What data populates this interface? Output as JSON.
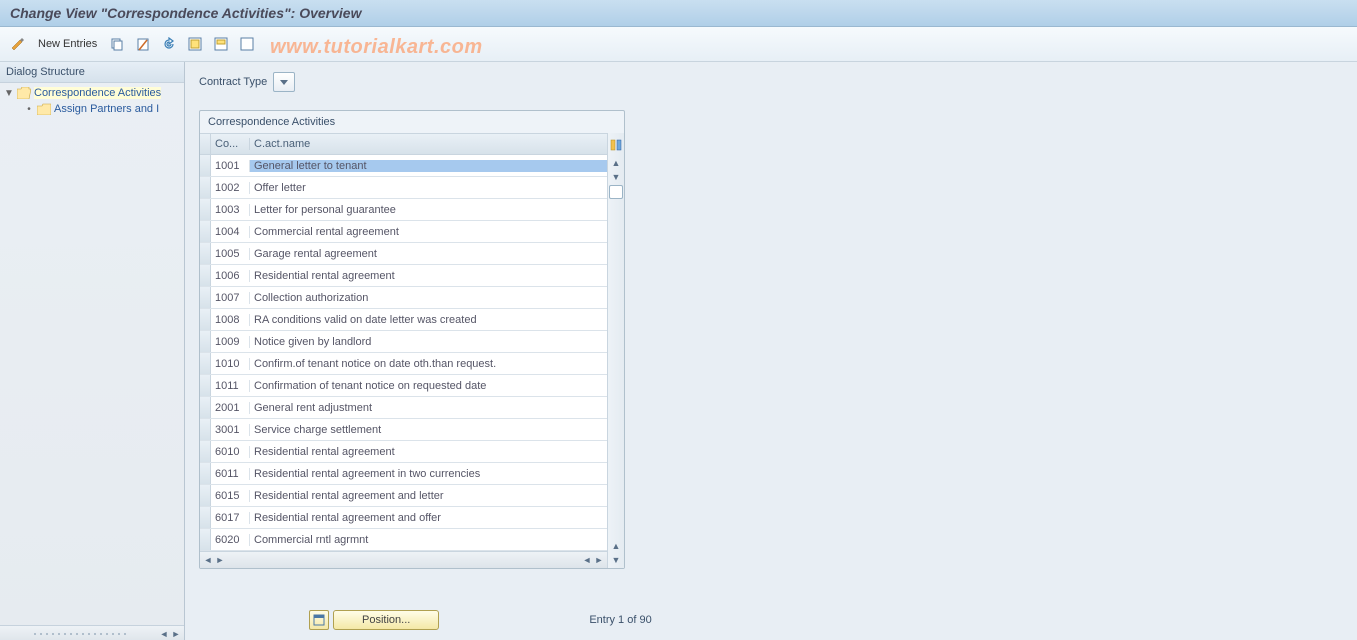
{
  "title": "Change View \"Correspondence Activities\": Overview",
  "watermark": "www.tutorialkart.com",
  "toolbar": {
    "new_entries_label": "New Entries"
  },
  "tree": {
    "header": "Dialog Structure",
    "nodes": [
      {
        "label": "Correspondence Activities",
        "expanded": true,
        "selected": true,
        "open": true
      },
      {
        "label": "Assign Partners and I",
        "expanded": false,
        "selected": false,
        "open": false
      }
    ]
  },
  "contract_type": {
    "label": "Contract Type",
    "value": ""
  },
  "table": {
    "title": "Correspondence Activities",
    "columns": {
      "code": "Co...",
      "name": "C.act.name"
    },
    "rows": [
      {
        "code": "1001",
        "name": "General letter to tenant",
        "selected": true
      },
      {
        "code": "1002",
        "name": "Offer letter"
      },
      {
        "code": "1003",
        "name": "Letter for personal guarantee"
      },
      {
        "code": "1004",
        "name": "Commercial rental agreement"
      },
      {
        "code": "1005",
        "name": "Garage rental agreement"
      },
      {
        "code": "1006",
        "name": "Residential rental agreement"
      },
      {
        "code": "1007",
        "name": "Collection authorization"
      },
      {
        "code": "1008",
        "name": "RA conditions valid on date letter was created"
      },
      {
        "code": "1009",
        "name": "Notice given by landlord"
      },
      {
        "code": "1010",
        "name": "Confirm.of tenant notice on date oth.than request."
      },
      {
        "code": "1011",
        "name": "Confirmation of tenant notice on requested date"
      },
      {
        "code": "2001",
        "name": "General rent adjustment"
      },
      {
        "code": "3001",
        "name": "Service charge settlement"
      },
      {
        "code": "6010",
        "name": "Residential rental agreement"
      },
      {
        "code": "6011",
        "name": "Residential rental agreement in two currencies"
      },
      {
        "code": "6015",
        "name": "Residential rental agreement and letter"
      },
      {
        "code": "6017",
        "name": "Residential rental agreement and offer"
      },
      {
        "code": "6020",
        "name": "Commercial rntl agrmnt"
      }
    ]
  },
  "footer": {
    "position_label": "Position...",
    "entry_status": "Entry 1 of 90"
  }
}
